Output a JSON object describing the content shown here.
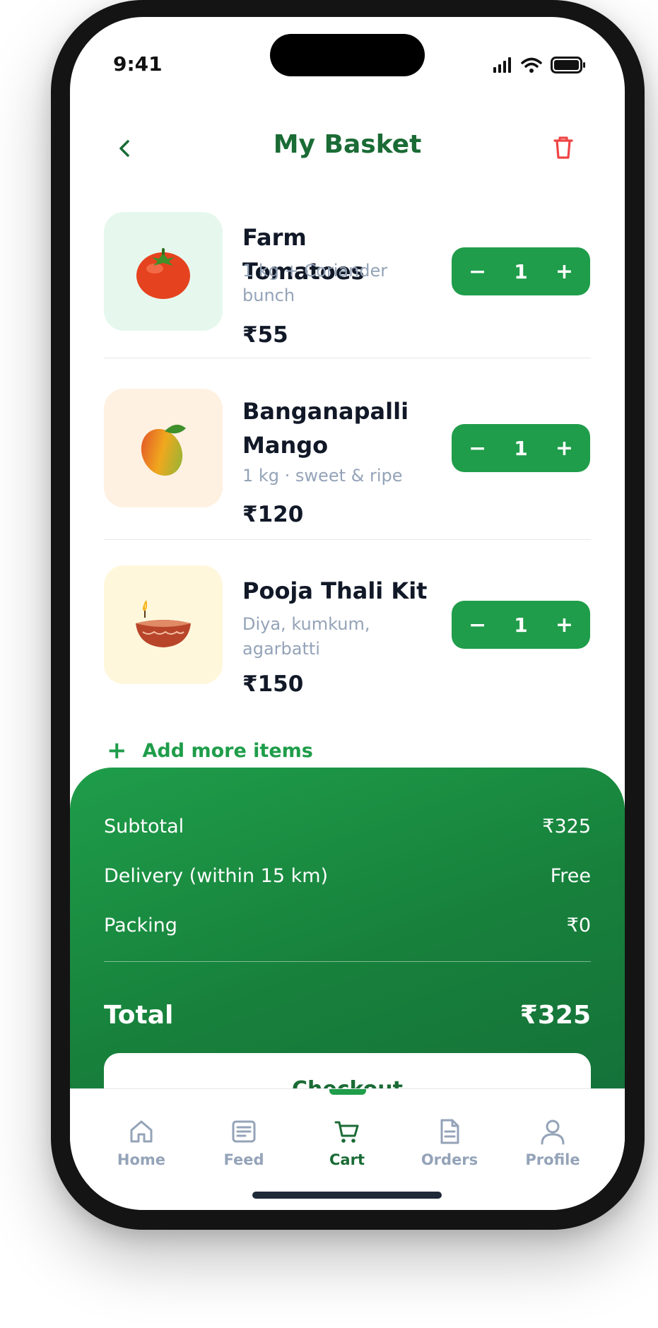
{
  "status_bar": {
    "time": "9:41"
  },
  "header": {
    "title": "My Basket"
  },
  "items": [
    {
      "name": "Farm Tomatoes",
      "desc": "1 kg + Coriander bunch",
      "price": "₹55",
      "qty": "1",
      "icon": "tomato-icon",
      "bg": "#e6f8ee"
    },
    {
      "name": "Banganapalli Mango",
      "desc": "1 kg · sweet & ripe",
      "price": "₹120",
      "qty": "1",
      "icon": "mango-icon",
      "bg": "#fff1e2"
    },
    {
      "name": "Pooja Thali Kit",
      "desc": "Diya, kumkum, agarbatti",
      "price": "₹150",
      "qty": "1",
      "icon": "diya-icon",
      "bg": "#fff7dc"
    }
  ],
  "stepper": {
    "minus": "−",
    "plus": "+"
  },
  "add_more": {
    "icon": "plus-icon",
    "label": "Add more items"
  },
  "summary": {
    "subtotal_label": "Subtotal",
    "subtotal_value": "₹325",
    "delivery_label": "Delivery (within 15 km)",
    "delivery_value": "Free",
    "packing_label": "Packing",
    "packing_value": "₹0",
    "total_label": "Total",
    "total_value": "₹325",
    "checkout_label": "Checkout"
  },
  "tabs": [
    {
      "label": "Home",
      "icon": "home-icon",
      "active": false
    },
    {
      "label": "Feed",
      "icon": "feed-icon",
      "active": false
    },
    {
      "label": "Cart",
      "icon": "cart-icon",
      "active": true
    },
    {
      "label": "Orders",
      "icon": "orders-icon",
      "active": false
    },
    {
      "label": "Profile",
      "icon": "profile-icon",
      "active": false
    }
  ],
  "colors": {
    "brand_green": "#1f9d4a",
    "dark_green": "#1a6b35",
    "danger_red": "#ef4444",
    "muted": "#94a3b8"
  }
}
